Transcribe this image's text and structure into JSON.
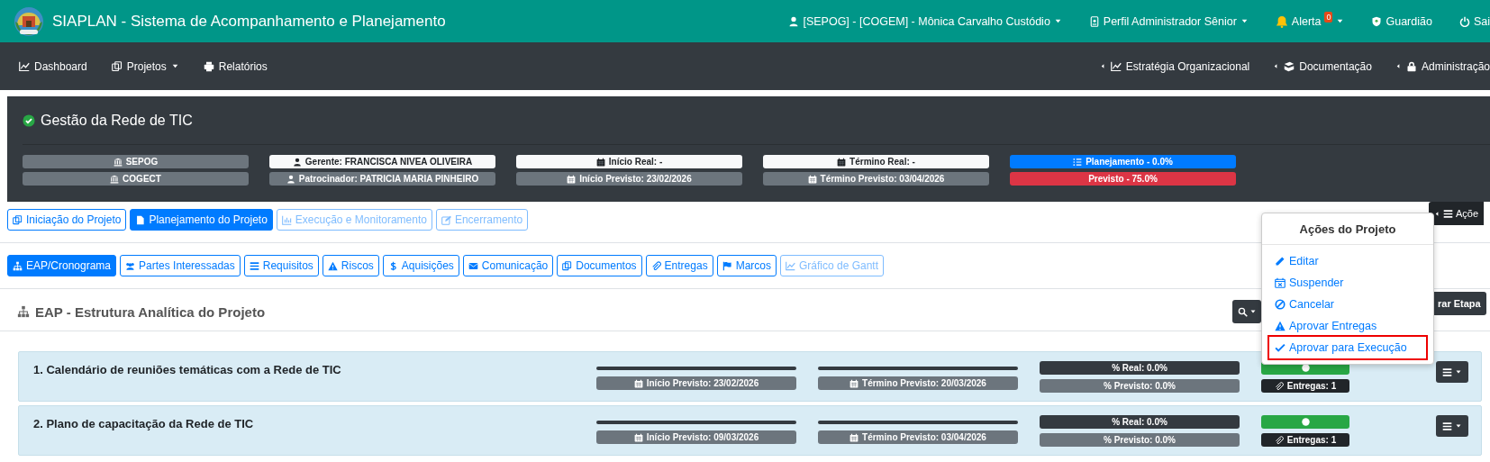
{
  "header": {
    "app_title": "SIAPLAN - Sistema de Acompanhamento e Planejamento",
    "user_menu": "[SEPOG] - [COGEM] - Mônica Carvalho Custódio",
    "profile_menu": "Perfil Administrador Sênior",
    "alert": {
      "label": "Alerta",
      "count": "0"
    },
    "guardian": "Guardião",
    "logout": "Sai"
  },
  "nav": {
    "left": [
      "Dashboard",
      "Projetos",
      "Relatórios"
    ],
    "right": [
      "Estratégia Organizacional",
      "Documentação",
      "Administração"
    ]
  },
  "project": {
    "title": "Gestão da Rede de TIC",
    "info": [
      [
        {
          "text": "SEPOG",
          "kind": "secondary"
        },
        {
          "text": "COGECT",
          "kind": "secondary"
        }
      ],
      [
        {
          "text": "Gerente: FRANCISCA NIVEA OLIVEIRA",
          "kind": "light"
        },
        {
          "text": "Patrocinador: PATRICIA MARIA PINHEIRO",
          "kind": "secondary"
        }
      ],
      [
        {
          "text": "Início Real: -",
          "kind": "light"
        },
        {
          "text": "Início Previsto: 23/02/2026",
          "kind": "secondary"
        }
      ],
      [
        {
          "text": "Término Real: -",
          "kind": "light"
        },
        {
          "text": "Término Previsto: 03/04/2026",
          "kind": "secondary"
        }
      ],
      [
        {
          "text": "Planejamento - 0.0%",
          "kind": "primary"
        },
        {
          "text": "Previsto - 75.0%",
          "kind": "danger"
        }
      ]
    ]
  },
  "phase_tabs": [
    {
      "label": "Iniciação do Projeto",
      "selected": false,
      "disabled": false
    },
    {
      "label": "Planejamento do Projeto",
      "selected": true,
      "disabled": false
    },
    {
      "label": "Execução e Monitoramento",
      "selected": false,
      "disabled": true
    },
    {
      "label": "Encerramento",
      "selected": false,
      "disabled": true
    }
  ],
  "section_tabs": [
    {
      "label": "EAP/Cronograma",
      "selected": true,
      "disabled": false
    },
    {
      "label": "Partes Interessadas",
      "selected": false,
      "disabled": false
    },
    {
      "label": "Requisitos",
      "selected": false,
      "disabled": false
    },
    {
      "label": "Riscos",
      "selected": false,
      "disabled": false
    },
    {
      "label": "Aquisições",
      "selected": false,
      "disabled": false
    },
    {
      "label": "Comunicação",
      "selected": false,
      "disabled": false
    },
    {
      "label": "Documentos",
      "selected": false,
      "disabled": false
    },
    {
      "label": "Entregas",
      "selected": false,
      "disabled": false
    },
    {
      "label": "Marcos",
      "selected": false,
      "disabled": false
    },
    {
      "label": "Gráfico de Gantt",
      "selected": false,
      "disabled": true
    }
  ],
  "actions_button": "Açõe",
  "actions_menu": {
    "title": "Ações do Projeto",
    "items": [
      {
        "label": "Editar",
        "highlighted": false
      },
      {
        "label": "Suspender",
        "highlighted": false
      },
      {
        "label": "Cancelar",
        "highlighted": false
      },
      {
        "label": "Aprovar Entregas",
        "highlighted": false
      },
      {
        "label": "Aprovar para Execução",
        "highlighted": true
      }
    ]
  },
  "eap": {
    "title": "EAP - Estrutura Analítica do Projeto",
    "stage_button": "rar Etapa"
  },
  "stages": [
    {
      "name": "1. Calendário de reuniões temáticas com a Rede de TIC",
      "planned_start": "Início Previsto: 23/02/2026",
      "planned_end": "Término Previsto: 20/03/2026",
      "real": "% Real: 0.0%",
      "planned_pct": "% Previsto: 0.0%",
      "deliveries": "Entregas: 1"
    },
    {
      "name": "2. Plano de capacitação da Rede de TIC",
      "planned_start": "Início Previsto: 09/03/2026",
      "planned_end": "Término Previsto: 03/04/2026",
      "real": "% Real: 0.0%",
      "planned_pct": "% Previsto: 0.0%",
      "deliveries": "Entregas: 1"
    }
  ]
}
